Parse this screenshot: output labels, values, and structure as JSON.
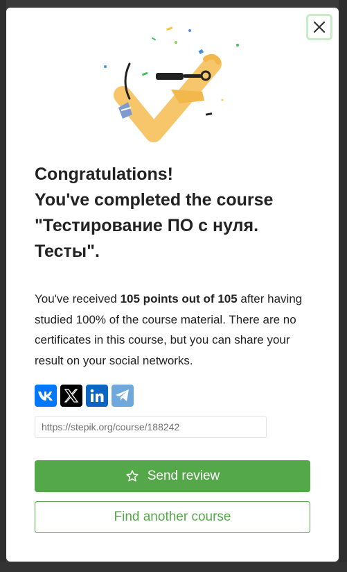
{
  "modal": {
    "close_icon": "close-icon",
    "headline": {
      "line1": "Congratulations!",
      "line2": "You've completed the course",
      "line3": "\"Тестирование ПО с нуля.",
      "line4": "Тесты\"."
    },
    "message": {
      "before": "You've received ",
      "points": "105 points out of 105",
      "after": " after having studied 100% of the course material. There are no certificates in this course, but you can share your result on your social networks."
    },
    "share": {
      "networks": [
        {
          "name": "vk",
          "icon": "vk-icon",
          "color": "#0077ff"
        },
        {
          "name": "x",
          "icon": "x-icon",
          "color": "#000000"
        },
        {
          "name": "linkedin",
          "icon": "linkedin-icon",
          "color": "#0a66c2"
        },
        {
          "name": "telegram",
          "icon": "telegram-icon",
          "color": "#6fa8dc"
        }
      ],
      "link_value": "https://stepik.org/course/188242"
    },
    "buttons": {
      "review_label": "Send review",
      "review_icon": "star-icon",
      "find_label": "Find another course"
    },
    "accent_color": "#54a849"
  }
}
